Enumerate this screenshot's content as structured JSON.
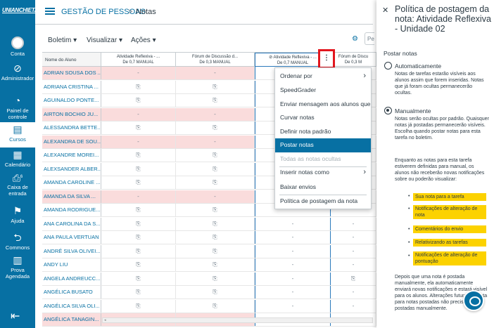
{
  "nav": {
    "logo": "UNIANCHIETA",
    "items": [
      {
        "label": "Conta",
        "icon": "account-icon"
      },
      {
        "label": "Administrador",
        "icon": "admin-icon"
      },
      {
        "label": "Painel de controle",
        "icon": "dashboard-icon"
      },
      {
        "label": "Cursos",
        "icon": "courses-icon"
      },
      {
        "label": "Calendário",
        "icon": "calendar-icon"
      },
      {
        "label": "Caixa de entrada",
        "icon": "inbox-icon",
        "badge": "6"
      },
      {
        "label": "Ajuda",
        "icon": "help-icon"
      },
      {
        "label": "Commons",
        "icon": "commons-icon"
      },
      {
        "label": "Prova Agendada",
        "icon": "scheduled-exam-icon"
      }
    ],
    "collapse_icon": "collapse-icon"
  },
  "breadcrumb": {
    "course": "GESTÃO DE PESSOAS",
    "sep": ">",
    "page": "Notas"
  },
  "toolbar": {
    "gradebook": "Boletim ▾",
    "view": "Visualizar ▾",
    "actions": "Ações ▾",
    "search_placeholder": "Pe"
  },
  "columns": [
    {
      "title": "Nome do Aluno"
    },
    {
      "title": "Atividade Reflexiva - ...",
      "sub": "De 0,7 MANUAL"
    },
    {
      "title": "Fórum de Discussão d...",
      "sub": "De 0,3 MANUAL"
    },
    {
      "title": "Atividade Reflexiva - ...",
      "sub": "De 0,7 MANUAL"
    },
    {
      "title": "Fórum de Discu",
      "sub": "De 0,3 M"
    }
  ],
  "rows": [
    {
      "name": "ADRIAN SOUSA DOS ...",
      "c1": "-",
      "c2": "-",
      "c3": "",
      "c4": "",
      "pink": true
    },
    {
      "name": "ADRIANA CRISTINA ...",
      "c1": "⎘",
      "c2": "⎘",
      "c3": "",
      "c4": "",
      "pink": false
    },
    {
      "name": "AGUINALDO PONTE...",
      "c1": "⎘",
      "c2": "⎘",
      "c3": "",
      "c4": "",
      "pink": false
    },
    {
      "name": "AIRTON BOCHIO JU...",
      "c1": "-",
      "c2": "-",
      "c3": "",
      "c4": "",
      "pink": true
    },
    {
      "name": "ALESSANDRA BETTE...",
      "c1": "⎘",
      "c2": "⎘",
      "c3": "",
      "c4": "",
      "pink": false
    },
    {
      "name": "ALEXANDRA DE SOU...",
      "c1": "-",
      "c2": "-",
      "c3": "",
      "c4": "",
      "pink": true
    },
    {
      "name": "ALEXANDRE MOREI...",
      "c1": "⎘",
      "c2": "⎘",
      "c3": "",
      "c4": "",
      "pink": false
    },
    {
      "name": "ALEXSANDER ALBER...",
      "c1": "⎘",
      "c2": "⎘",
      "c3": "",
      "c4": "",
      "pink": false
    },
    {
      "name": "AMANDA CAROLINE ...",
      "c1": "⎘",
      "c2": "⎘",
      "c3": "",
      "c4": "",
      "pink": false
    },
    {
      "name": "AMANDA DA SILVA ...",
      "c1": "-",
      "c2": "-",
      "c3": "",
      "c4": "",
      "pink": true
    },
    {
      "name": "AMANDA RODRIGUE...",
      "c1": "⎘",
      "c2": "⎘",
      "c3": "",
      "c4": "",
      "pink": false
    },
    {
      "name": "ANA CAROLINA DA S...",
      "c1": "⎘",
      "c2": "⎘",
      "c3": "-",
      "c4": "-",
      "pink": false
    },
    {
      "name": "ANA PAULA VERTUAN",
      "c1": "⎘",
      "c2": "⎘",
      "c3": "-",
      "c4": "-",
      "pink": false
    },
    {
      "name": "ANDRÉ SILVA OLIVEI...",
      "c1": "⎘",
      "c2": "⎘",
      "c3": "-",
      "c4": "-",
      "pink": false
    },
    {
      "name": "ANDY LIU",
      "c1": "⎘",
      "c2": "⎘",
      "c3": "-",
      "c4": "-",
      "pink": false
    },
    {
      "name": "ANGELA ANDREUCC...",
      "c1": "⎘",
      "c2": "⎘",
      "c3": "-",
      "c4": "⎘",
      "pink": false
    },
    {
      "name": "ANGÉLICA BUSATO",
      "c1": "⎘",
      "c2": "⎘",
      "c3": "-",
      "c4": "-",
      "pink": false
    },
    {
      "name": "ANGÉLICA SILVA OLI...",
      "c1": "⎘",
      "c2": "⎘",
      "c3": "-",
      "c4": "-",
      "pink": false
    },
    {
      "name": "ANGÉLICA TANAGIN...",
      "c1": "-",
      "c2": "-",
      "c3": "-",
      "c4": "-",
      "pink": true
    }
  ],
  "menu": {
    "items": [
      {
        "label": "Ordenar por",
        "submenu": true
      },
      {
        "label": "SpeedGrader"
      },
      {
        "label": "Enviar mensagem aos alunos que"
      },
      {
        "label": "Curvar notas"
      },
      {
        "label": "Definir nota padrão"
      },
      {
        "label": "Postar notas",
        "active": true
      },
      {
        "label": "Todas as notas ocultas",
        "disabled": true
      },
      {
        "label": "Inserir notas como",
        "submenu": true
      },
      {
        "label": "Baixar envios"
      },
      {
        "label": "Política de postagem da nota"
      }
    ]
  },
  "tray": {
    "title": "Política de postagem da nota: Atividade Reflexiva - Unidade 02",
    "section": "Postar notas",
    "auto_label": "Automaticamente",
    "auto_desc": "Notas de tarefas estarão visíveis aos alunos assim que forem inseridas. Notas que já foram ocultas permanecerão ocultas.",
    "manual_label": "Manualmente",
    "manual_desc": "Notas serão ocultas por padrão. Quaisquer notas já postadas permanecerão visíveis. Escolha quando postar notas para esta tarefa no boletim.",
    "manual_note": "Enquanto as notas para esta tarefa estiverem definidas para manual, os alunos não receberão novas notificações sobre ou poderão visualizar:",
    "bullets": [
      "Sua nota para a tarefa",
      "Notificações de alteração de nota",
      "Comentários do envio",
      "Relativizando as tarefas",
      "Notificações de alteração de pontuação"
    ],
    "footer": "Depois que uma nota é postada manualmente, ela automaticamente enviará novas notificações e estará visível para os alunos. Alterações futuras da nota para notas postadas não precisarão ser postadas manualmente.",
    "highlight_color": "#fcd200"
  }
}
